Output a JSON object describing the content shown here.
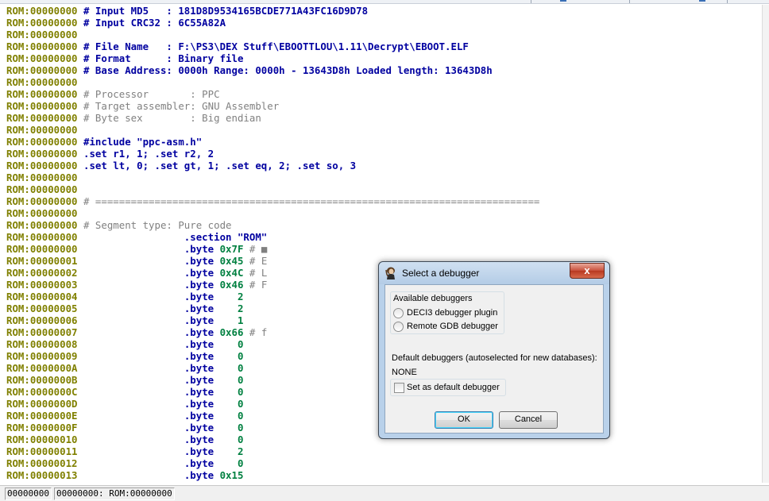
{
  "listing": {
    "lines": [
      {
        "addr": "ROM:00000000",
        "text": " # Input MD5   : 181D8D9534165BCDE771A43FC16D9D78",
        "style": "cmt-blue"
      },
      {
        "addr": "ROM:00000000",
        "text": " # Input CRC32 : 6C55A82A",
        "style": "cmt-blue"
      },
      {
        "addr": "ROM:00000000",
        "text": "",
        "style": "plain"
      },
      {
        "addr": "ROM:00000000",
        "text": " # File Name   : F:\\PS3\\DEX Stuff\\EBOOTTLOU\\1.11\\Decrypt\\EBOOT.ELF",
        "style": "cmt-blue"
      },
      {
        "addr": "ROM:00000000",
        "text": " # Format      : Binary file",
        "style": "cmt-blue"
      },
      {
        "addr": "ROM:00000000",
        "text": " # Base Address: 0000h Range: 0000h - 13643D8h Loaded length: 13643D8h",
        "style": "cmt-blue"
      },
      {
        "addr": "ROM:00000000",
        "text": "",
        "style": "plain"
      },
      {
        "addr": "ROM:00000000",
        "text": " # Processor       : PPC",
        "style": "cmt-gray"
      },
      {
        "addr": "ROM:00000000",
        "text": " # Target assembler: GNU Assembler",
        "style": "cmt-gray"
      },
      {
        "addr": "ROM:00000000",
        "text": " # Byte sex        : Big endian",
        "style": "cmt-gray"
      },
      {
        "addr": "ROM:00000000",
        "text": "",
        "style": "plain"
      },
      {
        "addr": "ROM:00000000",
        "text": " #include \"ppc-asm.h\"",
        "style": "dir"
      },
      {
        "addr": "ROM:00000000",
        "text": " .set r1, 1; .set r2, 2",
        "style": "dir"
      },
      {
        "addr": "ROM:00000000",
        "text": " .set lt, 0; .set gt, 1; .set eq, 2; .set so, 3",
        "style": "dir"
      },
      {
        "addr": "ROM:00000000",
        "text": "",
        "style": "plain"
      },
      {
        "addr": "ROM:00000000",
        "text": "",
        "style": "plain"
      },
      {
        "addr": "ROM:00000000",
        "text": " # ===========================================================================",
        "style": "cmt-gray"
      },
      {
        "addr": "ROM:00000000",
        "text": "",
        "style": "plain"
      },
      {
        "addr": "ROM:00000000",
        "text": " # Segment type: Pure code",
        "style": "cmt-gray"
      },
      {
        "addr": "ROM:00000000",
        "text": "                  .section \"ROM\"",
        "style": "dir"
      },
      {
        "addr": "ROM:00000000",
        "op": ".byte",
        "val": "0x7F",
        "cmt": " # ■"
      },
      {
        "addr": "ROM:00000001",
        "op": ".byte",
        "val": "0x45",
        "cmt": " # E"
      },
      {
        "addr": "ROM:00000002",
        "op": ".byte",
        "val": "0x4C",
        "cmt": " # L"
      },
      {
        "addr": "ROM:00000003",
        "op": ".byte",
        "val": "0x46",
        "cmt": " # F"
      },
      {
        "addr": "ROM:00000004",
        "op": ".byte",
        "val": "   2",
        "cmt": ""
      },
      {
        "addr": "ROM:00000005",
        "op": ".byte",
        "val": "   2",
        "cmt": ""
      },
      {
        "addr": "ROM:00000006",
        "op": ".byte",
        "val": "   1",
        "cmt": ""
      },
      {
        "addr": "ROM:00000007",
        "op": ".byte",
        "val": "0x66",
        "cmt": " # f"
      },
      {
        "addr": "ROM:00000008",
        "op": ".byte",
        "val": "   0",
        "cmt": ""
      },
      {
        "addr": "ROM:00000009",
        "op": ".byte",
        "val": "   0",
        "cmt": ""
      },
      {
        "addr": "ROM:0000000A",
        "op": ".byte",
        "val": "   0",
        "cmt": ""
      },
      {
        "addr": "ROM:0000000B",
        "op": ".byte",
        "val": "   0",
        "cmt": ""
      },
      {
        "addr": "ROM:0000000C",
        "op": ".byte",
        "val": "   0",
        "cmt": ""
      },
      {
        "addr": "ROM:0000000D",
        "op": ".byte",
        "val": "   0",
        "cmt": ""
      },
      {
        "addr": "ROM:0000000E",
        "op": ".byte",
        "val": "   0",
        "cmt": ""
      },
      {
        "addr": "ROM:0000000F",
        "op": ".byte",
        "val": "   0",
        "cmt": ""
      },
      {
        "addr": "ROM:00000010",
        "op": ".byte",
        "val": "   0",
        "cmt": ""
      },
      {
        "addr": "ROM:00000011",
        "op": ".byte",
        "val": "   2",
        "cmt": ""
      },
      {
        "addr": "ROM:00000012",
        "op": ".byte",
        "val": "   0",
        "cmt": ""
      },
      {
        "addr": "ROM:00000013",
        "op": ".byte",
        "val": "0x15",
        "cmt": ""
      }
    ]
  },
  "statusbar": {
    "cell1": "00000000",
    "cell2": "00000000: ROM:00000000"
  },
  "dialog": {
    "title": "Select a debugger",
    "close_glyph": "x",
    "group_label": "Available debuggers",
    "options": [
      "DECI3 debugger plugin",
      "Remote GDB debugger"
    ],
    "default_label": "Default debuggers (autoselected for new databases):",
    "default_value": "NONE",
    "checkbox_label": "Set as default debugger",
    "ok_label": "OK",
    "cancel_label": "Cancel"
  },
  "colors": {
    "address": "#808000",
    "directive": "#0000a0",
    "number": "#008040",
    "comment": "#808080"
  }
}
